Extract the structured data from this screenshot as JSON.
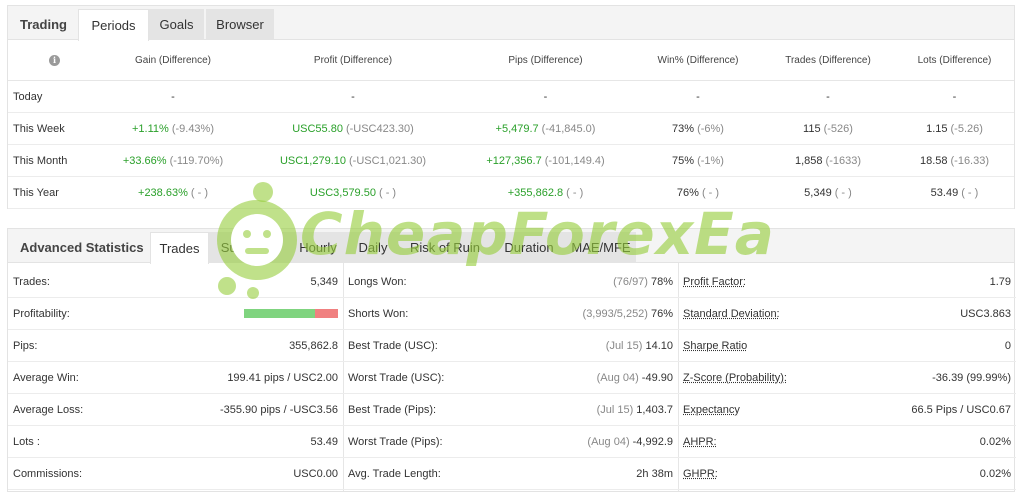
{
  "periods": {
    "tabs": [
      "Trading",
      "Periods",
      "Goals",
      "Browser"
    ],
    "columns": [
      "Gain (Difference)",
      "Profit (Difference)",
      "Pips (Difference)",
      "Win% (Difference)",
      "Trades (Difference)",
      "Lots (Difference)"
    ],
    "rows": [
      {
        "label": "Today",
        "cells": [
          {
            "v": "-",
            "d": ""
          },
          {
            "v": "-",
            "d": ""
          },
          {
            "v": "-",
            "d": ""
          },
          {
            "v": "-",
            "d": ""
          },
          {
            "v": "-",
            "d": ""
          },
          {
            "v": "-",
            "d": ""
          }
        ]
      },
      {
        "label": "This Week",
        "cells": [
          {
            "v": "+1.11%",
            "d": "(-9.43%)"
          },
          {
            "v": "USC55.80",
            "d": "(-USC423.30)"
          },
          {
            "v": "+5,479.7",
            "d": "(-41,845.0)"
          },
          {
            "v": "73%",
            "d": "(-6%)"
          },
          {
            "v": "115",
            "d": "(-526)"
          },
          {
            "v": "1.15",
            "d": "(-5.26)"
          }
        ]
      },
      {
        "label": "This Month",
        "cells": [
          {
            "v": "+33.66%",
            "d": "(-119.70%)"
          },
          {
            "v": "USC1,279.10",
            "d": "(-USC1,021.30)"
          },
          {
            "v": "+127,356.7",
            "d": "(-101,149.4)"
          },
          {
            "v": "75%",
            "d": "(-1%)"
          },
          {
            "v": "1,858",
            "d": "(-1633)"
          },
          {
            "v": "18.58",
            "d": "(-16.33)"
          }
        ]
      },
      {
        "label": "This Year",
        "cells": [
          {
            "v": "+238.63%",
            "d": "( - )"
          },
          {
            "v": "USC3,579.50",
            "d": "( - )"
          },
          {
            "v": "+355,862.8",
            "d": "( - )"
          },
          {
            "v": "76%",
            "d": "( - )"
          },
          {
            "v": "5,349",
            "d": "( - )"
          },
          {
            "v": "53.49",
            "d": "( - )"
          }
        ]
      }
    ]
  },
  "advanced": {
    "tabs": [
      "Advanced Statistics",
      "Trades",
      "Summary",
      "Hourly",
      "Daily",
      "Risk of Ruin",
      "Duration",
      "MAE/MFE"
    ],
    "col1": [
      {
        "label": "Trades:",
        "value": "5,349"
      },
      {
        "label": "Profitability:",
        "value": ""
      },
      {
        "label": "Pips:",
        "value": "355,862.8"
      },
      {
        "label": "Average Win:",
        "value": "199.41 pips / USC2.00"
      },
      {
        "label": "Average Loss:",
        "value": "-355.90 pips / -USC3.56"
      },
      {
        "label": "Lots :",
        "value": "53.49"
      },
      {
        "label": "Commissions:",
        "value": "USC0.00"
      }
    ],
    "col2": [
      {
        "label": "Longs Won:",
        "extra": "(76/97)",
        "value": "78%"
      },
      {
        "label": "Shorts Won:",
        "extra": "(3,993/5,252)",
        "value": "76%"
      },
      {
        "label": "Best Trade (USC):",
        "extra": "(Jul 15)",
        "value": "14.10"
      },
      {
        "label": "Worst Trade (USC):",
        "extra": "(Aug 04)",
        "value": "-49.90"
      },
      {
        "label": "Best Trade (Pips):",
        "extra": "(Jul 15)",
        "value": "1,403.7"
      },
      {
        "label": "Worst Trade (Pips):",
        "extra": "(Aug 04)",
        "value": "-4,992.9"
      },
      {
        "label": "Avg. Trade Length:",
        "extra": "",
        "value": "2h 38m"
      }
    ],
    "col3": [
      {
        "label": "Profit Factor:",
        "value": "1.79"
      },
      {
        "label": "Standard Deviation:",
        "value": "USC3.863"
      },
      {
        "label": "Sharpe Ratio",
        "value": "0"
      },
      {
        "label": "Z-Score (Probability):",
        "value": "-36.39 (99.99%)"
      },
      {
        "label": "Expectancy",
        "value": "66.5 Pips / USC0.67"
      },
      {
        "label": "AHPR:",
        "value": "0.02%"
      },
      {
        "label": "GHPR:",
        "value": "0.02%"
      }
    ],
    "profitability": {
      "win_fraction": 0.76,
      "win_color": "#7fd47f",
      "loss_color": "#f08080"
    }
  },
  "watermark": {
    "text": "CheapForexEa",
    "color": "#96cd3c"
  }
}
